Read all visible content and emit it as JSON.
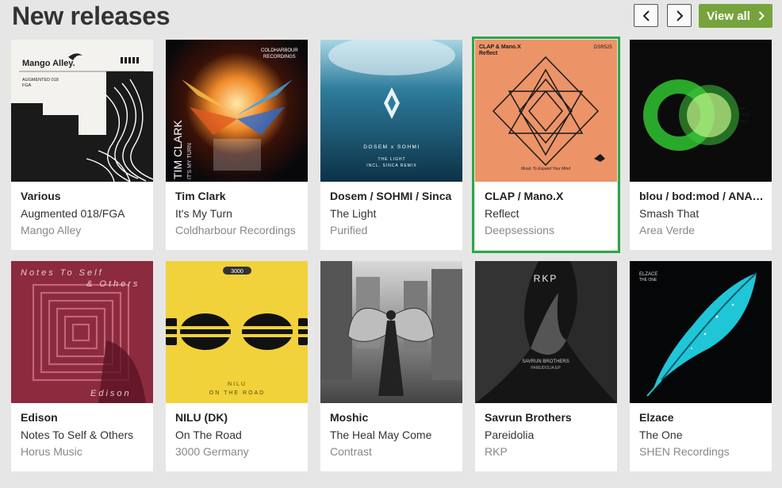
{
  "section": {
    "title": "New releases",
    "view_all_label": "View all"
  },
  "colors": {
    "accent": "#77a33d",
    "selected_border": "#2aa845"
  },
  "icons": {
    "prev": "chevron-left-icon",
    "next": "chevron-right-icon",
    "view_all": "chevron-right-icon"
  },
  "releases": [
    {
      "artist": "Various",
      "title": "Augmented 018/FGA",
      "label": "Mango Alley",
      "cover": {
        "brand": "Mango Alley.",
        "line1": "AUGMENTED 018",
        "line2": "FGA"
      }
    },
    {
      "artist": "Tim Clark",
      "title": "It's My Turn",
      "label": "Coldharbour Recordings",
      "cover": {
        "brand": "COLDHARBOUR",
        "brand2": "RECORDINGS",
        "name": "TIM CLARK",
        "sub": "IT'S MY TURN"
      }
    },
    {
      "artist": "Dosem / SOHMI / Sinca",
      "title": "The Light",
      "label": "Purified",
      "cover": {
        "line1": "DOSEM x SOHMI",
        "line2": "THE LIGHT",
        "line3": "INCL. SINCA REMIX"
      }
    },
    {
      "artist": "CLAP / Mano.X",
      "title": "Reflect",
      "label": "Deepsessions",
      "selected": true,
      "cover": {
        "line1": "CLAP & Mano.X",
        "line2": "Reflect",
        "code": "DSR525",
        "tagline": "Music To Expand Your Mind"
      }
    },
    {
      "artist": "blou / bod:mod / ANA…",
      "title": "Smash That",
      "label": "Area Verde",
      "cover": {}
    },
    {
      "artist": "Edison",
      "title": "Notes To Self & Others",
      "label": "Horus Music",
      "cover": {
        "line1": "Notes To Self",
        "line2": "& Others",
        "name": "Edison"
      }
    },
    {
      "artist": "NILU (DK)",
      "title": "On The Road",
      "label": "3000 Germany",
      "cover": {
        "badge": "3000",
        "name": "NILU",
        "sub": "ON THE ROAD"
      }
    },
    {
      "artist": "Moshic",
      "title": "The Heal May Come",
      "label": "Contrast",
      "cover": {}
    },
    {
      "artist": "Savrun Brothers",
      "title": "Pareidolia",
      "label": "RKP",
      "cover": {
        "brand": "RKP",
        "name": "SAVRUN BROTHERS",
        "sub": "PAREIDOLIA EP"
      }
    },
    {
      "artist": "Elzace",
      "title": "The One",
      "label": "SHEN Recordings",
      "cover": {
        "name": "ELZACE",
        "sub": "THE ONE"
      }
    }
  ]
}
